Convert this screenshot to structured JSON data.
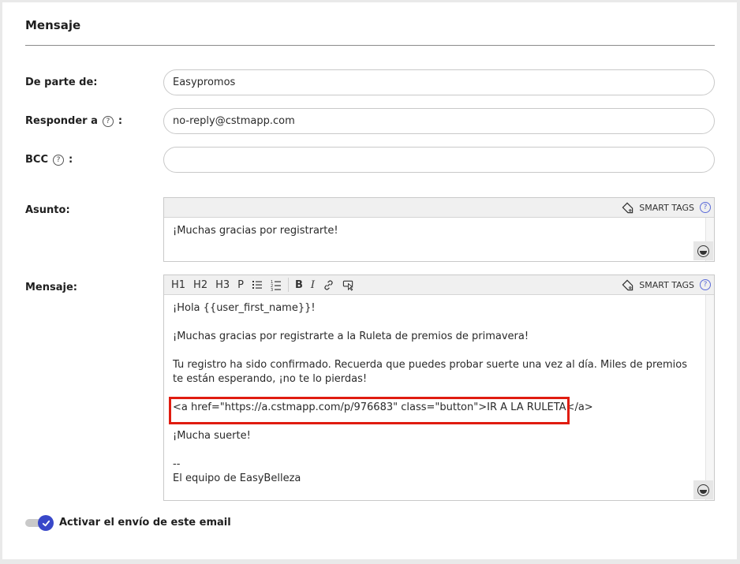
{
  "section": {
    "title": "Mensaje"
  },
  "fields": {
    "from": {
      "label": "De parte de:",
      "value": "Easypromos"
    },
    "reply_to": {
      "label": "Responder a",
      "suffix": ":",
      "value": "no-reply@cstmapp.com"
    },
    "bcc": {
      "label": "BCC",
      "suffix": ":",
      "value": ""
    }
  },
  "subject": {
    "label": "Asunto:",
    "smart_tags_label": "SMART TAGS",
    "value": "¡Muchas gracias por registrarte!"
  },
  "message": {
    "label": "Mensaje:",
    "smart_tags_label": "SMART TAGS",
    "toolbar": {
      "h1": "H1",
      "h2": "H2",
      "h3": "H3",
      "p": "P",
      "bold": "B",
      "italic": "I"
    },
    "lines": [
      "¡Hola {{user_first_name}}!",
      "",
      "¡Muchas gracias por registrarte a la Ruleta de premios de primavera!",
      "",
      "Tu registro ha sido confirmado. Recuerda que puedes probar suerte una vez al día. Miles de premios te están esperando, ¡no te lo pierdas!",
      "",
      "<a href=\"https://a.cstmapp.com/p/976683\" class=\"button\">IR A LA RULETA</a>",
      "",
      "¡Mucha suerte!",
      "",
      "--",
      "El equipo de EasyBelleza"
    ]
  },
  "activation": {
    "label": "Activar el envío de este email",
    "enabled": true
  },
  "help_glyph": "?",
  "colors": {
    "accent": "#3948c9",
    "highlight": "#e01c10",
    "help_blue": "#5b6bd8"
  },
  "icons": [
    "help-circle-icon",
    "tag-icon",
    "emoji-icon",
    "bullet-list-icon",
    "numbered-list-icon",
    "link-icon",
    "insert-icon",
    "check-icon"
  ]
}
